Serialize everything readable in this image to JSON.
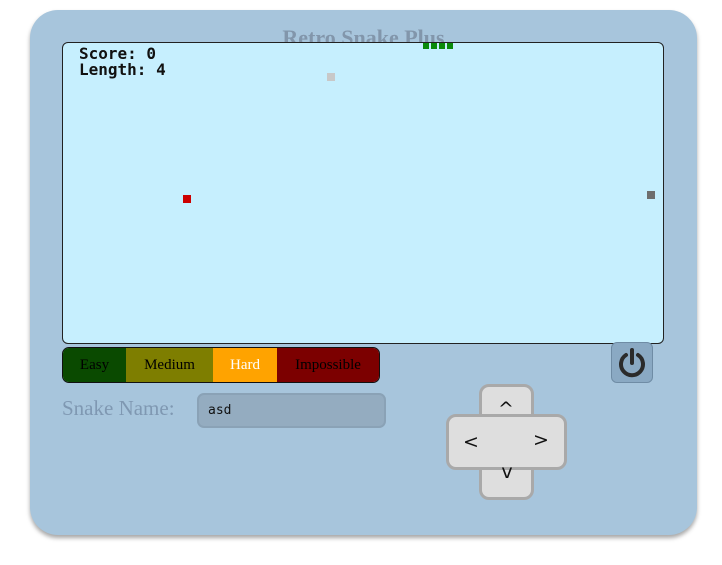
{
  "app": {
    "title": "Retro Snake Plus"
  },
  "hud": {
    "score_label": "Score: 0",
    "length_label": "Length: 4"
  },
  "difficulty": {
    "options": [
      "Easy",
      "Medium",
      "Hard",
      "Impossible"
    ],
    "selected": "Hard"
  },
  "name_field": {
    "label": "Snake Name:",
    "value": "asd"
  },
  "dpad": {
    "up": "^",
    "left": "<",
    "right": ">",
    "down": "v"
  },
  "colors": {
    "console": "#a7c5dc",
    "screen": "#c6effe",
    "snake": "#0a8a0a",
    "food": "#cc0000",
    "grey_item": "#6e6e6e",
    "light_item": "#c8c8c8",
    "easy": "#0a4a00",
    "medium": "#7e7e00",
    "hard": "#ffa300",
    "impossible": "#7c0000"
  },
  "icons": [
    "power-icon"
  ]
}
